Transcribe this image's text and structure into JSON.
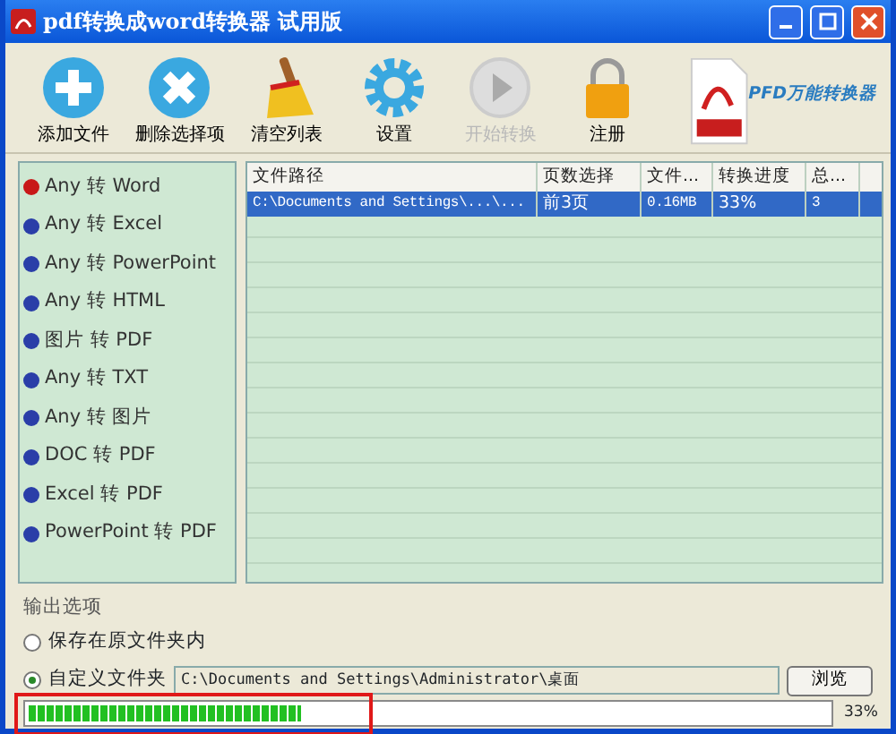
{
  "window": {
    "title": "pdf转换成word转换器 试用版"
  },
  "toolbar": [
    {
      "kind": "add",
      "label": "添加文件",
      "disabled": false
    },
    {
      "kind": "delete",
      "label": "删除选择项",
      "disabled": false
    },
    {
      "kind": "clear",
      "label": "清空列表",
      "disabled": false
    },
    {
      "kind": "settings",
      "label": "设置",
      "disabled": false
    },
    {
      "kind": "start",
      "label": "开始转换",
      "disabled": true
    },
    {
      "kind": "register",
      "label": "注册",
      "disabled": false
    }
  ],
  "brand": {
    "text": "PFD万能转换器"
  },
  "formats": [
    {
      "label": "Any 转 Word",
      "selected": true
    },
    {
      "label": "Any 转 Excel",
      "selected": false
    },
    {
      "label": "Any 转 PowerPoint",
      "selected": false
    },
    {
      "label": "Any 转 HTML",
      "selected": false
    },
    {
      "label": "图片 转 PDF",
      "selected": false
    },
    {
      "label": "Any 转 TXT",
      "selected": false
    },
    {
      "label": "Any 转 图片",
      "selected": false
    },
    {
      "label": "DOC 转 PDF",
      "selected": false
    },
    {
      "label": "Excel 转 PDF",
      "selected": false
    },
    {
      "label": "PowerPoint 转 PDF",
      "selected": false
    }
  ],
  "table": {
    "columns": [
      "文件路径",
      "页数选择",
      "文件...",
      "转换进度",
      "总..."
    ],
    "rows": [
      {
        "cells": [
          "C:\\Documents and Settings\\...\\...",
          "前3页",
          "0.16MB",
          "33%",
          "3"
        ],
        "selected": true
      }
    ]
  },
  "output": {
    "heading": "输出选项",
    "options": [
      {
        "label": "保存在原文件夹内",
        "selected": false
      },
      {
        "label": "自定义文件夹",
        "selected": true
      }
    ],
    "folder": "C:\\Documents and Settings\\Administrator\\桌面",
    "browse": "浏览"
  },
  "progress": {
    "level": 0.34,
    "text": "33%"
  }
}
